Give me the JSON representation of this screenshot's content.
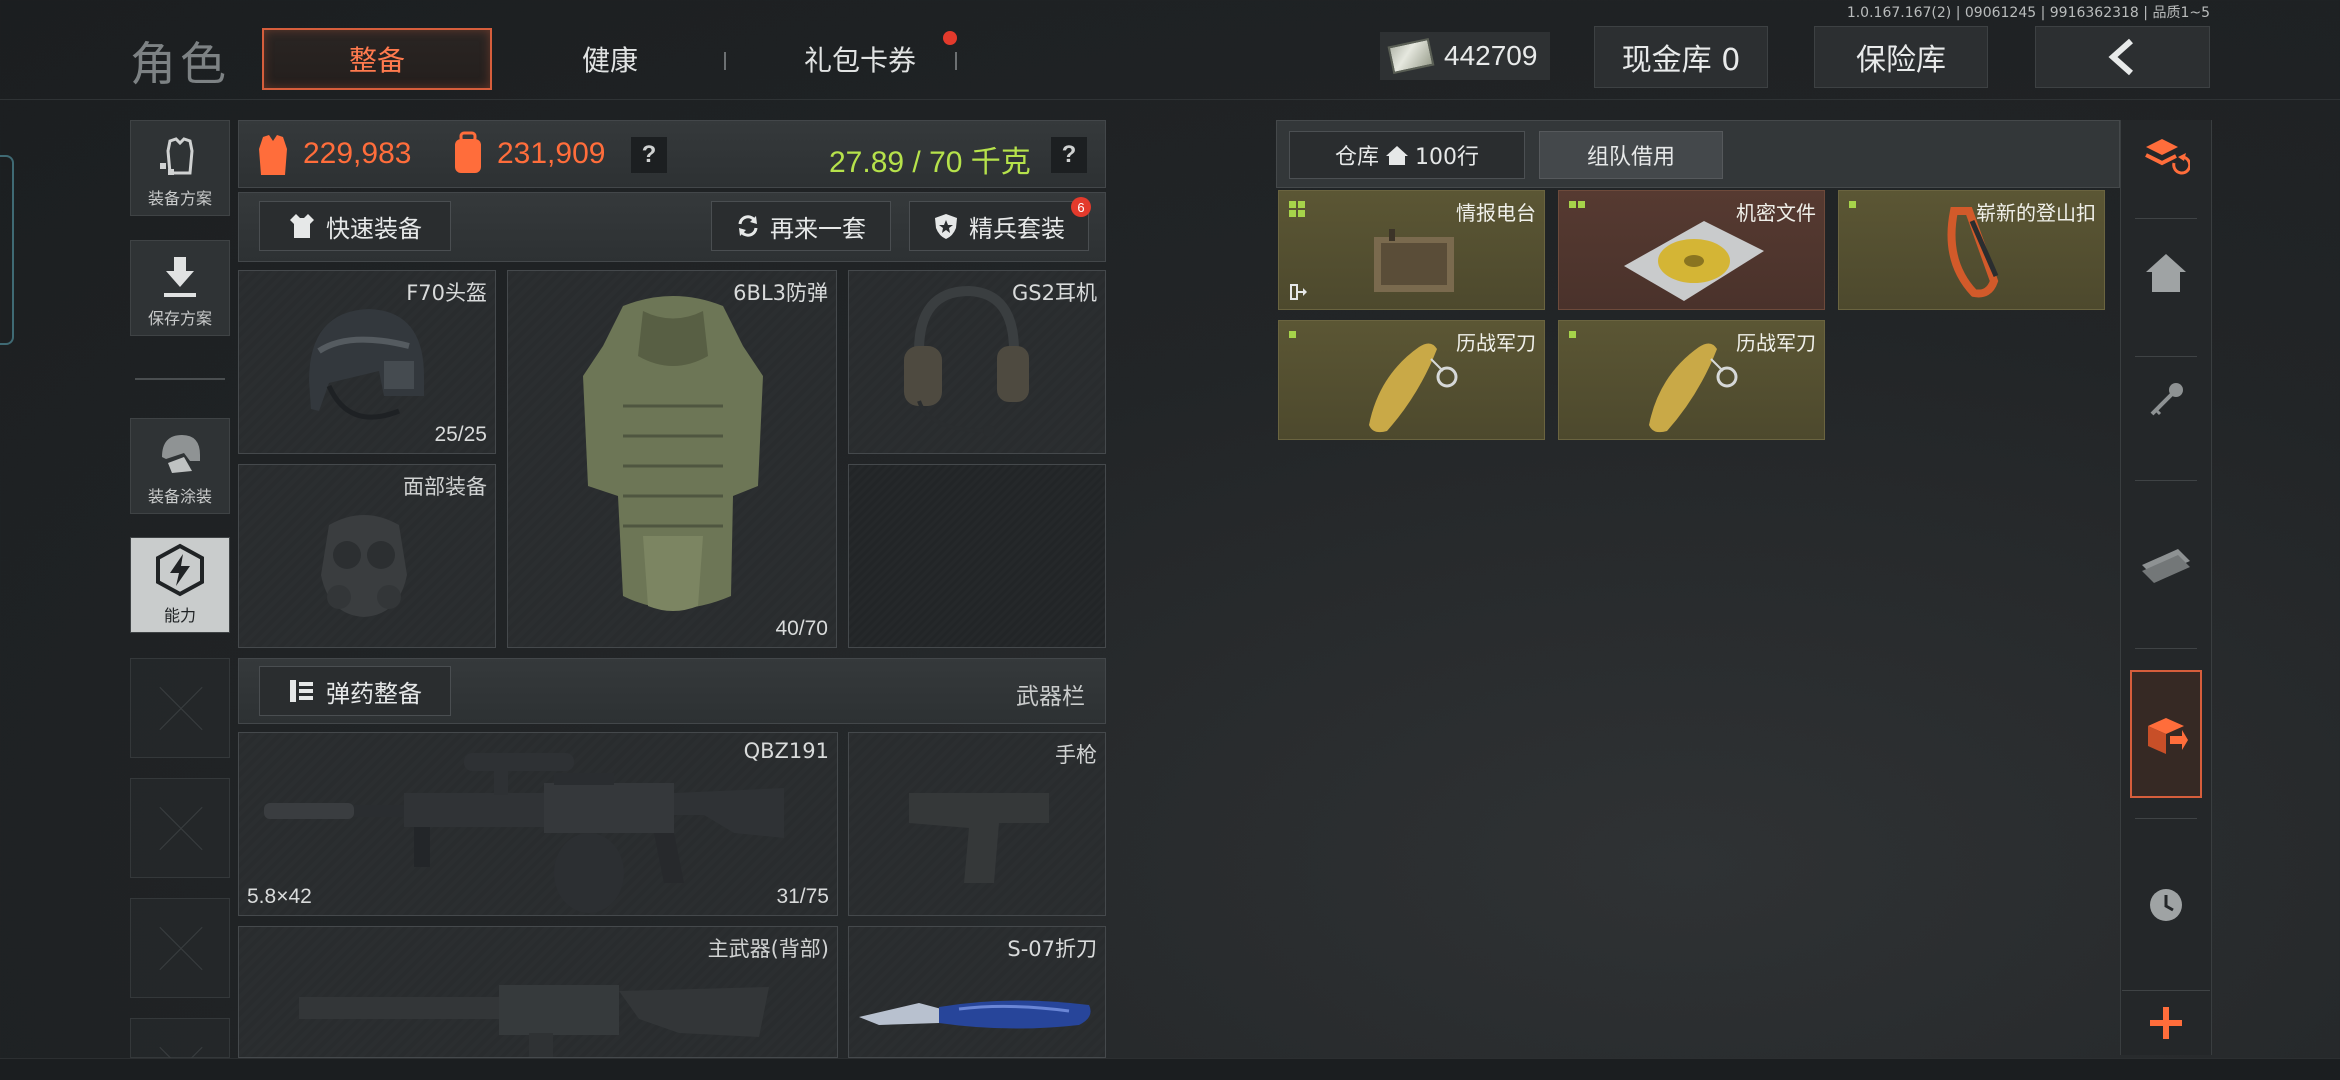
{
  "version": "1.0.167.167(2) | 09061245 | 9916362318 | 品质1~5",
  "header": {
    "title": "角色",
    "tabs": [
      {
        "label": "整备",
        "active": true
      },
      {
        "label": "健康",
        "active": false
      },
      {
        "label": "礼包卡券",
        "active": false,
        "has_notification": true
      }
    ],
    "money": "442709",
    "cash_vault": "现金库 0",
    "safe_box": "保险库",
    "back_icon": "chevron-left-icon"
  },
  "left_menu": [
    {
      "label": "装备方案",
      "icon": "armor-plan-icon"
    },
    {
      "label": "保存方案",
      "icon": "download-icon"
    },
    {
      "label": "装备涂装",
      "icon": "helmet-paint-icon"
    },
    {
      "label": "能力",
      "icon": "ability-hexagon-icon",
      "active": true
    }
  ],
  "equipment": {
    "value_carried": "229,983",
    "value_backpack": "231,909",
    "weight": "27.89 / 70 千克",
    "help": "?",
    "quick_equip": "快速装备",
    "again_set": "再来一套",
    "elite_set": "精兵套装",
    "elite_badge": "6",
    "slots": {
      "helmet": {
        "name": "F70头盔",
        "count": "25/25"
      },
      "armor": {
        "name": "6BL3防弹",
        "count": "40/70"
      },
      "headset": {
        "name": "GS2耳机"
      },
      "face": {
        "name": "面部装备"
      }
    },
    "ammo_button": "弹药整备",
    "weapon_bar_label": "武器栏",
    "weapons": {
      "primary": {
        "name": "QBZ191",
        "caliber": "5.8×42",
        "count": "31/75"
      },
      "pistol": {
        "name": "手枪"
      },
      "back_primary": {
        "name": "主武器(背部)"
      },
      "knife": {
        "name": "S-07折刀"
      }
    }
  },
  "warehouse": {
    "tab_storage": "仓库",
    "tab_storage_rows": "100行",
    "tab_team": "组队借用",
    "items": [
      {
        "name": "情报电台",
        "rarity_color": "#a6d34a"
      },
      {
        "name": "机密文件",
        "rarity_color": "#a6d34a"
      },
      {
        "name": "崭新的登山扣",
        "rarity_color": "#a6d34a"
      },
      {
        "name": "历战军刀",
        "rarity_color": "#a6d34a"
      },
      {
        "name": "历战军刀",
        "rarity_color": "#a6d34a"
      }
    ]
  },
  "right_sidebar": [
    {
      "icon": "stack-refresh-icon"
    },
    {
      "icon": "home-icon"
    },
    {
      "icon": "key-icon"
    },
    {
      "icon": "cash-icon"
    },
    {
      "icon": "box-download-icon",
      "active": true
    },
    {
      "icon": "clock-icon"
    },
    {
      "icon": "plus-icon"
    }
  ],
  "colors": {
    "accent_orange": "#ff6d3b",
    "weight_green": "#b6e24b",
    "active_border": "#d65e3c"
  }
}
